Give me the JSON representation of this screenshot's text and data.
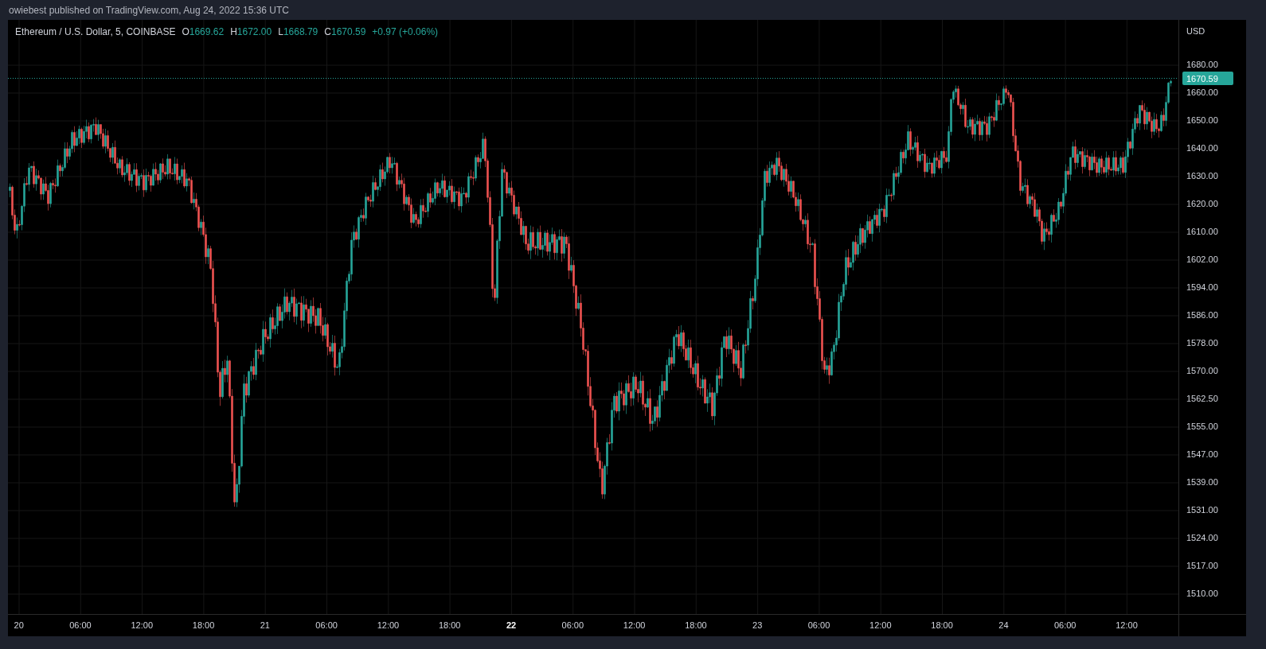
{
  "header": {
    "text": "owiebest published on TradingView.com, Aug 24, 2022 15:36 UTC"
  },
  "legend": {
    "symbol": "Ethereum / U.S. Dollar, 5, COINBASE",
    "ohlc": [
      {
        "label": "O",
        "value": "1669.62"
      },
      {
        "label": "H",
        "value": "1672.00"
      },
      {
        "label": "L",
        "value": "1668.79"
      },
      {
        "label": "C",
        "value": "1670.59"
      }
    ],
    "change": "+0.97 (+0.06%)"
  },
  "price_axis": {
    "currency": "USD",
    "current_price": "1670.59",
    "labels": [
      "1680.00",
      "1660.00",
      "1650.00",
      "1640.00",
      "1630.00",
      "1620.00",
      "1610.00",
      "1602.00",
      "1594.00",
      "1586.00",
      "1578.00",
      "1570.00",
      "1562.50",
      "1555.00",
      "1547.00",
      "1539.00",
      "1531.00",
      "1524.00",
      "1517.00",
      "1510.00"
    ]
  },
  "time_axis": {
    "labels": [
      {
        "text": "20",
        "emphasized": false
      },
      {
        "text": "06:00",
        "emphasized": false
      },
      {
        "text": "12:00",
        "emphasized": false
      },
      {
        "text": "18:00",
        "emphasized": false
      },
      {
        "text": "21",
        "emphasized": false
      },
      {
        "text": "06:00",
        "emphasized": false
      },
      {
        "text": "12:00",
        "emphasized": false
      },
      {
        "text": "18:00",
        "emphasized": false
      },
      {
        "text": "22",
        "emphasized": true
      },
      {
        "text": "06:00",
        "emphasized": false
      },
      {
        "text": "12:00",
        "emphasized": false
      },
      {
        "text": "18:00",
        "emphasized": false
      },
      {
        "text": "23",
        "emphasized": false
      },
      {
        "text": "06:00",
        "emphasized": false
      },
      {
        "text": "12:00",
        "emphasized": false
      },
      {
        "text": "18:00",
        "emphasized": false
      },
      {
        "text": "24",
        "emphasized": false
      },
      {
        "text": "06:00",
        "emphasized": false
      },
      {
        "text": "12:00",
        "emphasized": false
      }
    ]
  }
}
